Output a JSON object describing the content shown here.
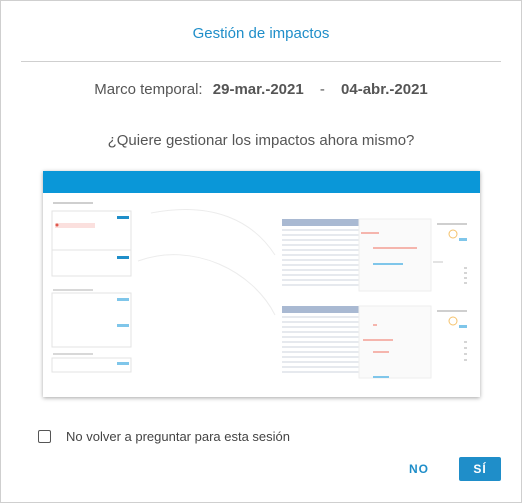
{
  "dialog": {
    "title": "Gestión de impactos",
    "timeframe": {
      "label": "Marco temporal:",
      "start": "29-mar.-2021",
      "separator": "-",
      "end": "04-abr.-2021"
    },
    "question": "¿Quiere gestionar los impactos ahora mismo?",
    "preview": {
      "header_color": "#0a97d8"
    },
    "checkbox": {
      "label": "No volver a preguntar para esta sesión",
      "checked": false
    },
    "buttons": {
      "no": "NO",
      "yes": "SÍ"
    }
  },
  "colors": {
    "accent": "#1f8ec9"
  }
}
